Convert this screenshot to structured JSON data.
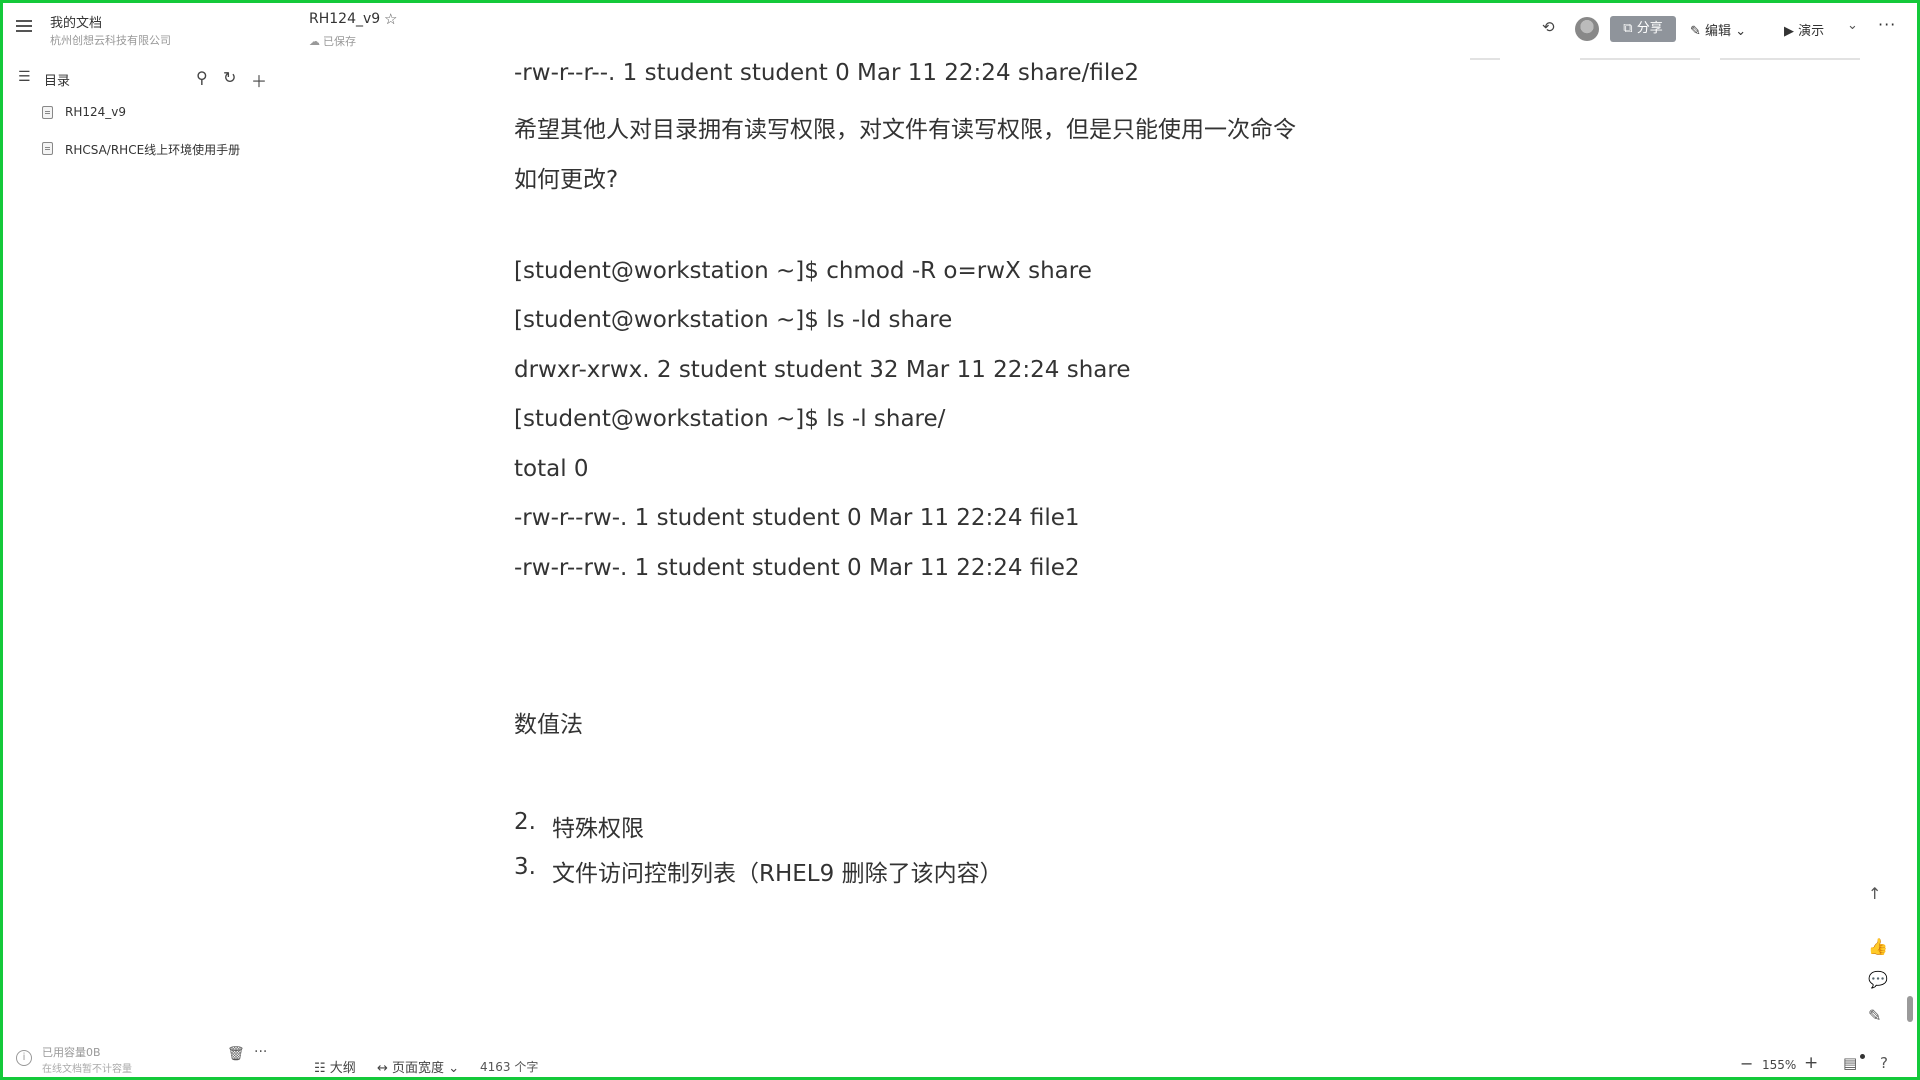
{
  "workspace": {
    "name": "我的文档",
    "org": "杭州创想云科技有限公司"
  },
  "document": {
    "title": "RH124_v9",
    "save_status": "已保存"
  },
  "toolbar": {
    "share_label": "分享",
    "edit_label": "编辑",
    "present_label": "演示",
    "more_label": "···"
  },
  "sidebar": {
    "toc_label": "目录",
    "items": [
      {
        "label": "RH124_v9"
      },
      {
        "label": "RHCSA/RHCE线上环境使用手册"
      }
    ]
  },
  "content": {
    "lines": [
      "-rw-r--r--. 1 student student 0 Mar 11 22:24 share/file2",
      "希望其他人对目录拥有读写权限，对文件有读写权限，但是只能使用一次命令",
      "如何更改?",
      "[student@workstation ~]$ chmod -R o=rwX share",
      "[student@workstation ~]$ ls -ld share",
      "drwxr-xrwx. 2 student student 32 Mar 11 22:24 share",
      "[student@workstation ~]$ ls -l share/",
      "total 0",
      "-rw-r--rw-. 1 student student 0 Mar 11 22:24 file1",
      "-rw-r--rw-. 1 student student 0 Mar 11 22:24 file2"
    ],
    "heading": "数值法",
    "list": [
      {
        "num": "2.",
        "text": "特殊权限"
      },
      {
        "num": "3.",
        "text": "文件访问控制列表（RHEL9 删除了该内容）"
      }
    ]
  },
  "footer": {
    "storage_used": "已用容量0B",
    "storage_note": "在线文档暂不计容量",
    "outline_label": "大纲",
    "width_label": "页面宽度",
    "word_count": "4163 个字",
    "zoom": "155%"
  },
  "icons": {
    "menu": "menu-icon",
    "star": "star-icon",
    "history": "history-icon",
    "search": "search-icon",
    "refresh": "refresh-icon",
    "add": "plus-icon"
  },
  "colors": {
    "frame": "#14c93a",
    "share_button": "#8f949b"
  }
}
